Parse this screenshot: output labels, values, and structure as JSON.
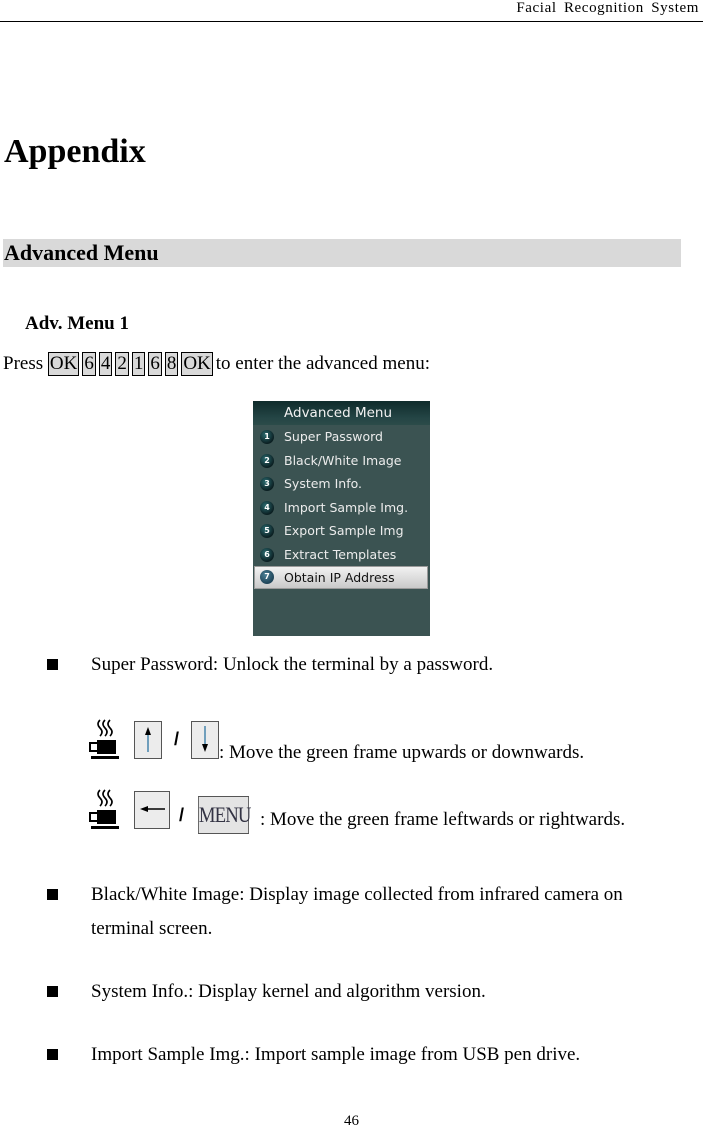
{
  "header": {
    "title": "Facial Recognition System"
  },
  "appendix_title": "Appendix",
  "section": {
    "title": "Advanced Menu"
  },
  "subsection": {
    "title": "Adv. Menu 1"
  },
  "instruction": {
    "prefix": "Press",
    "keys": [
      "OK",
      "6",
      "4",
      "2",
      "1",
      "6",
      "8",
      "OK"
    ],
    "suffix": "to enter the advanced menu:"
  },
  "device_menu": {
    "title": "Advanced Menu",
    "items": [
      {
        "num": "1",
        "label": "Super Password"
      },
      {
        "num": "2",
        "label": "Black/White Image"
      },
      {
        "num": "3",
        "label": "System Info."
      },
      {
        "num": "4",
        "label": "Import Sample Img."
      },
      {
        "num": "5",
        "label": "Export Sample Img"
      },
      {
        "num": "6",
        "label": "Extract Templates"
      },
      {
        "num": "7",
        "label": "Obtain IP Address"
      }
    ],
    "selected_index": 6,
    "colors": {
      "background": "#3b5352",
      "selected": "#d9d9d9"
    }
  },
  "bullets": [
    {
      "text": "Super Password: Unlock the terminal by a password."
    },
    {
      "text": "Black/White Image: Display image collected from infrared camera on terminal screen."
    },
    {
      "text": "System Info.: Display kernel and algorithm version."
    },
    {
      "text": "Import Sample Img.: Import sample image from USB pen drive."
    }
  ],
  "key_instructions": [
    {
      "icon": "coffee-cup-icon",
      "key_a": "↑",
      "separator": "/",
      "key_b": "↓",
      "text": ": Move the green frame upwards or downwards."
    },
    {
      "icon": "coffee-cup-icon",
      "key_a": "←",
      "separator": "/",
      "key_b": "MENU",
      "text": ": Move the green frame leftwards or rightwards."
    }
  ],
  "page_number": "46"
}
